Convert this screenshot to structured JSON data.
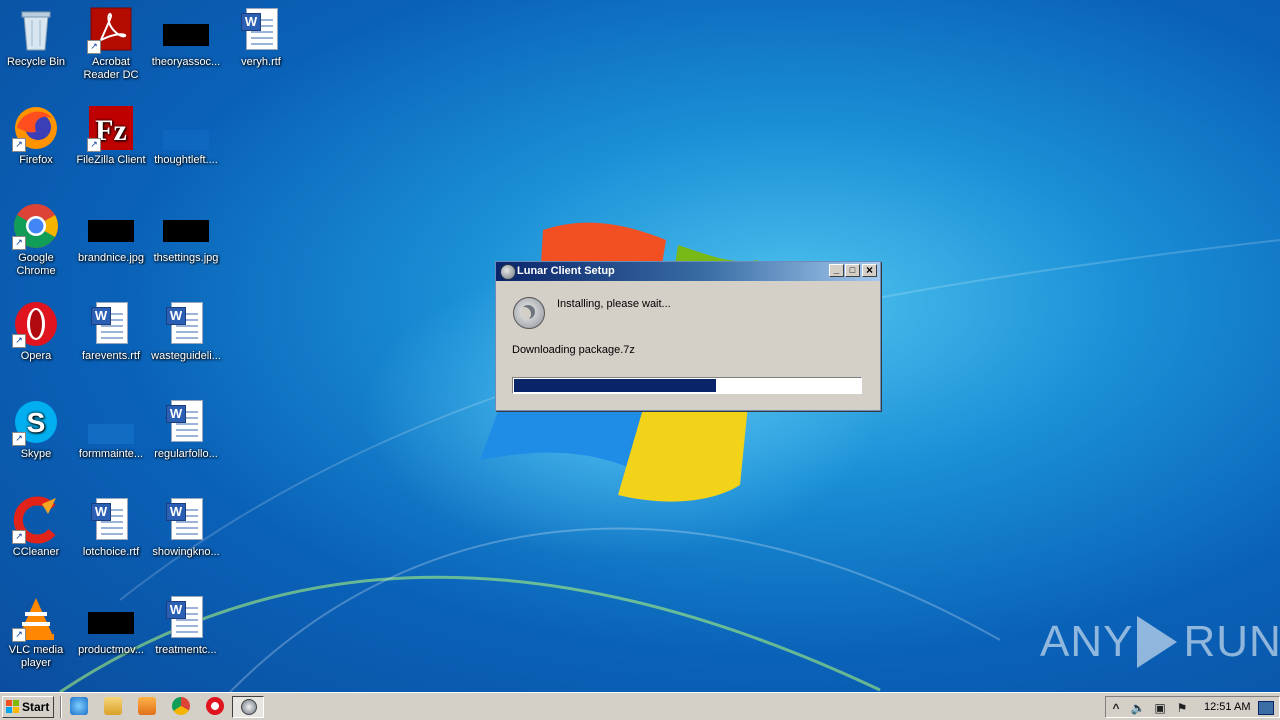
{
  "desktop": {
    "icons": [
      {
        "label": "Recycle Bin"
      },
      {
        "label": "Acrobat Reader DC"
      },
      {
        "label": "theoryassoc..."
      },
      {
        "label": "veryh.rtf"
      },
      {
        "label": "Firefox"
      },
      {
        "label": "FileZilla Client"
      },
      {
        "label": "thoughtleft...."
      },
      {
        "label": "Google Chrome"
      },
      {
        "label": "brandnice.jpg"
      },
      {
        "label": "thsettings.jpg"
      },
      {
        "label": "Opera"
      },
      {
        "label": "farevents.rtf"
      },
      {
        "label": "wasteguideli..."
      },
      {
        "label": "Skype"
      },
      {
        "label": "formmainte..."
      },
      {
        "label": "regularfollo..."
      },
      {
        "label": "CCleaner"
      },
      {
        "label": "lotchoice.rtf"
      },
      {
        "label": "showingkno..."
      },
      {
        "label": "VLC media player"
      },
      {
        "label": "productmov..."
      },
      {
        "label": "treatmentc..."
      }
    ]
  },
  "dialog": {
    "title": "Lunar Client Setup",
    "status": "Installing, please wait...",
    "detail": "Downloading package.7z",
    "progress": 0.58,
    "buttons": {
      "minimize": "_",
      "maximize": "□",
      "close": "×"
    }
  },
  "watermark": {
    "left": "ANY",
    "right": "RUN"
  },
  "taskbar": {
    "start_label": "Start",
    "clock": "12:51 AM",
    "tray_expand": "^"
  }
}
